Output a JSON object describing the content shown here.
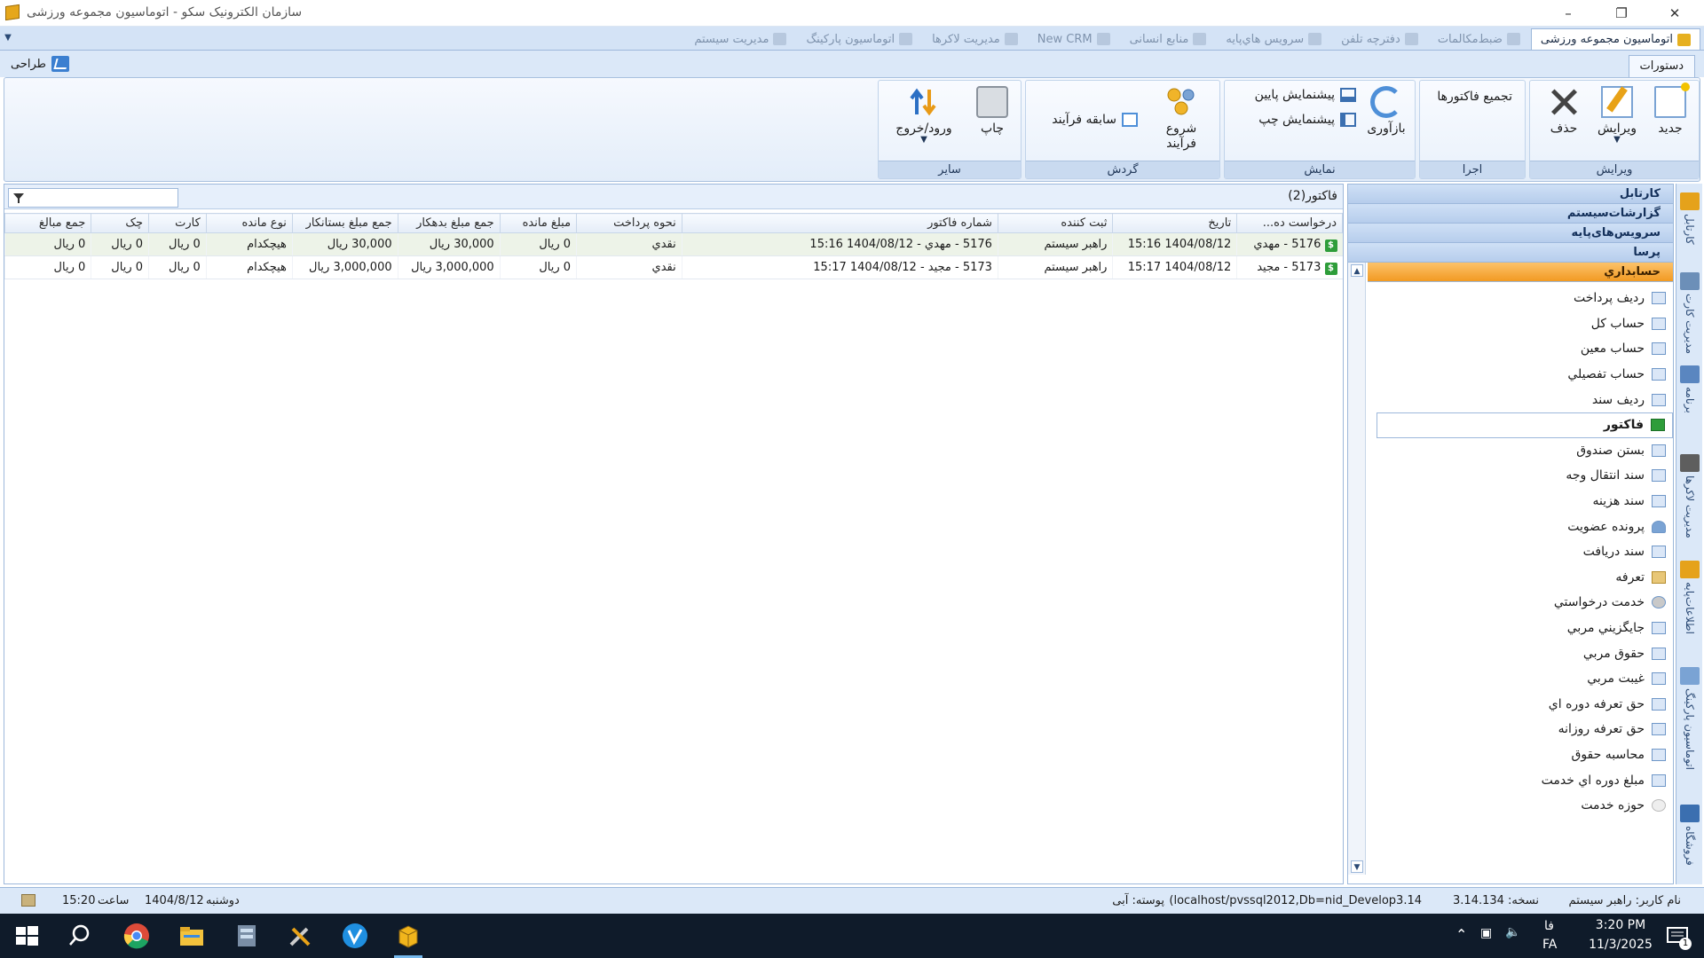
{
  "window": {
    "title": "سازمان الکترونیک سکو - اتوماسیون مجموعه ورزشی"
  },
  "tabs": [
    {
      "label": "اتوماسیون مجموعه ورزشی",
      "active": true
    },
    {
      "label": "ضبط‌مکالمات"
    },
    {
      "label": "دفترچه تلفن"
    },
    {
      "label": "سرویس هاي‌پایه"
    },
    {
      "label": "منابع انسانی"
    },
    {
      "label": "New CRM"
    },
    {
      "label": "مدیریت لاکرها"
    },
    {
      "label": "اتوماسیون پارکینگ"
    },
    {
      "label": "مدیریت سیستم"
    }
  ],
  "ribbon_tabs": {
    "commands": "دستورات",
    "design": "طراحی"
  },
  "ribbon": {
    "edit_group": {
      "label": "ویرایش",
      "new": "جدید",
      "edit": "ویرایش",
      "delete": "حذف"
    },
    "run_group": {
      "label": "اجرا",
      "aggregate": "تجمیع فاکتورها"
    },
    "view_group": {
      "label": "نمایش",
      "refresh": "بازآوری",
      "preview_bottom": "پیشنمایش پایین",
      "preview_left": "پیشنمایش چپ"
    },
    "flow_group": {
      "label": "گردش",
      "start_process": "شروع فرآیند",
      "process_history": "سابقه فرآیند"
    },
    "other_group": {
      "label": "سایر",
      "print": "چاپ",
      "inout": "ورود/خروج"
    }
  },
  "grid": {
    "title": "فاکتور(2)",
    "filter_placeholder": "",
    "columns": [
      "درخواست ده...",
      "تاریخ",
      "ثبت کننده",
      "شماره فاکتور",
      "نحوه پرداخت",
      "مبلغ مانده",
      "جمع مبلغ بدهکار",
      "جمع مبلغ بستانکار",
      "نوع مانده",
      "کارت",
      "چک",
      "جمع مبالغ"
    ],
    "rows": [
      [
        "5176 - مهدي",
        "1404/08/12 15:16",
        "راهبر سیستم",
        "5176 - مهدي - 1404/08/12 15:16",
        "نقدي",
        "0 ريال",
        "30,000 ريال",
        "30,000 ريال",
        "هیچکدام",
        "0 ريال",
        "0 ريال",
        "0 ريال"
      ],
      [
        "5173 - مجید",
        "1404/08/12 15:17",
        "راهبر سیستم",
        "5173 - مجید  - 1404/08/12 15:17",
        "نقدي",
        "0 ريال",
        "3,000,000 ريال",
        "3,000,000 ريال",
        "هیچکدام",
        "0 ريال",
        "0 ريال",
        "0 ريال"
      ]
    ]
  },
  "sidebar": {
    "sections": [
      "کارتابل",
      "گزارشات‌سیستم",
      "سرویس‌های‌پایه",
      "پرسا"
    ],
    "active_section": "حسابداري",
    "items": [
      {
        "label": "رديف پرداخت",
        "icon": "form-icon"
      },
      {
        "label": "حساب کل",
        "icon": "form-icon"
      },
      {
        "label": "حساب معين",
        "icon": "form-icon"
      },
      {
        "label": "حساب تفصيلي",
        "icon": "form-icon"
      },
      {
        "label": "رديف سند",
        "icon": "form-icon"
      },
      {
        "label": "فاکتور",
        "icon": "money-icon",
        "selected": true
      },
      {
        "label": "بستن صندوق",
        "icon": "form-icon"
      },
      {
        "label": "سند انتقال وجه",
        "icon": "form-icon"
      },
      {
        "label": "سند هزينه",
        "icon": "form-icon"
      },
      {
        "label": "پرونده عضويت",
        "icon": "user-icon"
      },
      {
        "label": "سند دريافت",
        "icon": "form-icon"
      },
      {
        "label": "تعرفه",
        "icon": "box-icon"
      },
      {
        "label": "خدمت درخواستي",
        "icon": "gear-icon"
      },
      {
        "label": "جايگزيني مربي",
        "icon": "form-icon"
      },
      {
        "label": "حقوق مربي",
        "icon": "form-icon"
      },
      {
        "label": "غيبت مربي",
        "icon": "form-icon"
      },
      {
        "label": "حق تعرفه دوره اي",
        "icon": "form-icon"
      },
      {
        "label": "حق تعرفه روزانه",
        "icon": "form-icon"
      },
      {
        "label": "محاسبه حقوق",
        "icon": "form-icon"
      },
      {
        "label": "مبلغ دوره اي خدمت",
        "icon": "form-icon"
      },
      {
        "label": "حوزه خدمت",
        "icon": "circle-icon"
      }
    ]
  },
  "vertical_tabs": [
    "کارتابل",
    "مدیریت کارت",
    "برنامه",
    "مدیریت لاکرها",
    "اطلاعات‌پایه",
    "اتوماسیون پارکینگ",
    "فروشگاه"
  ],
  "status": {
    "user": "نام کاربر: راهبر سیستم",
    "version": "نسخه: 3.14.134",
    "connection": "(localhost/pvssql2012,Db=nid_Develop3.14",
    "skin": "پوسته: آبی",
    "weekday": "دوشنبه",
    "date": "1404/8/12",
    "time_label": "ساعت",
    "time": "15:20"
  },
  "taskbar": {
    "lang": "FA",
    "lang_native": "فا",
    "clock_time": "3:20 PM",
    "clock_date": "11/3/2025",
    "notifications": "1"
  }
}
